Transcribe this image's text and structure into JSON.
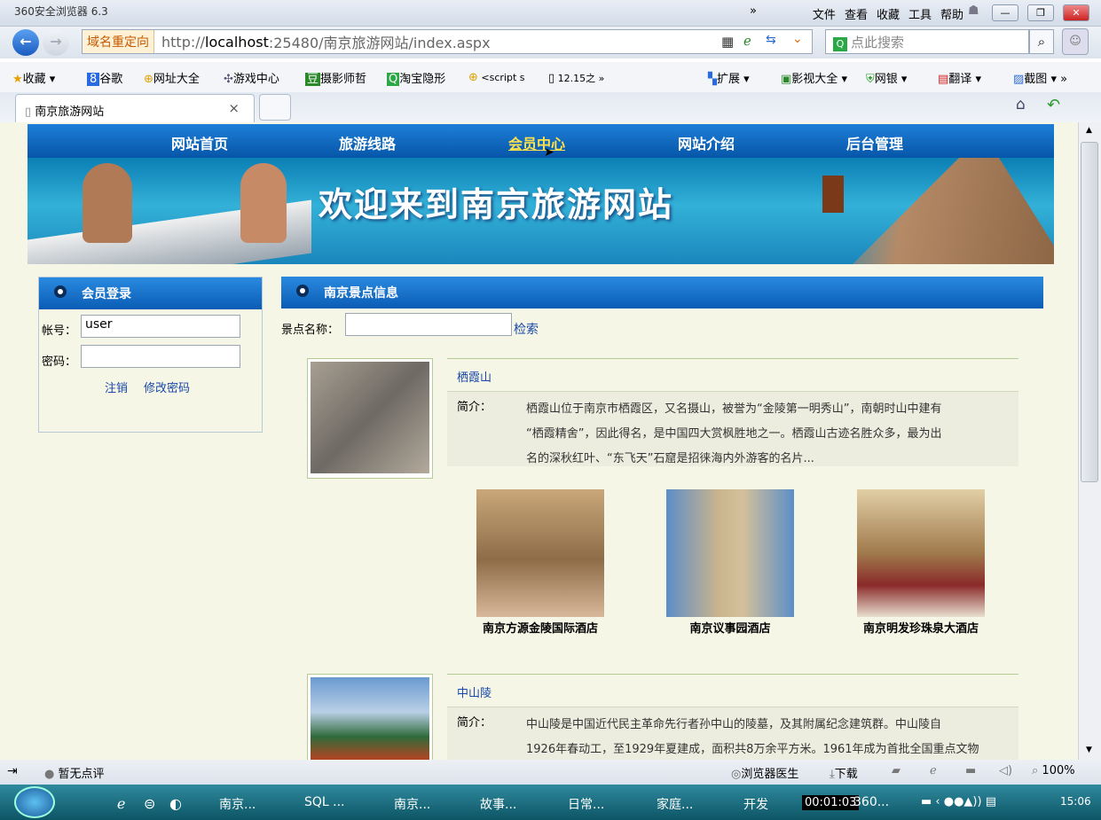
{
  "browser": {
    "title": "360安全浏览器 6.3",
    "menus": [
      "文件",
      "查看",
      "收藏",
      "工具",
      "帮助"
    ],
    "redirect_label": "域名重定向",
    "address_prefix": "http://",
    "address_host": "localhost",
    "address_rest": ":25480/南京旅游网站/index.aspx",
    "search_placeholder": "点此搜索"
  },
  "favorites": [
    "收藏",
    "谷歌",
    "网址大全",
    "游戏中心",
    "摄影师哲",
    "淘宝隐形",
    "<script s",
    "12.15之"
  ],
  "favorites_right": [
    "扩展",
    "影视大全",
    "网银",
    "翻译",
    "截图"
  ],
  "tab": {
    "title": "南京旅游网站",
    "close": "×"
  },
  "site": {
    "nav": [
      "网站首页",
      "旅游线路",
      "会员中心",
      "网站介绍",
      "后台管理"
    ],
    "banner_text": "欢迎来到南京旅游网站",
    "login": {
      "header": "会员登录",
      "account_label": "帐号：",
      "account_value": "user",
      "password_label": "密码：",
      "password_value": "",
      "logout": "注销",
      "change_password": "修改密码"
    },
    "scenic": {
      "header": "南京景点信息",
      "search_label": "景点名称：",
      "search_value": "",
      "search_button": "检索",
      "items": [
        {
          "name": "栖霞山",
          "intro_label": "简介：",
          "intro_lines": [
            "栖霞山位于南京市栖霞区，又名摄山，被誉为“金陵第一明秀山”，南朝时山中建有",
            "“栖霞精舍”，因此得名，是中国四大赏枫胜地之一。栖霞山古迹名胜众多，最为出",
            "名的深秋红叶、“东飞天”石窟是招徕海内外游客的名片..."
          ],
          "hotels": [
            "南京方源金陵国际酒店",
            "南京议事园酒店",
            "南京明发珍珠泉大酒店"
          ]
        },
        {
          "name": "中山陵",
          "intro_label": "简介：",
          "intro_lines": [
            "中山陵是中国近代民主革命先行者孙中山的陵墓，及其附属纪念建筑群。中山陵自",
            "1926年春动工，至1929年夏建成，面积共8万余平方米。1961年成为首批全国重点文物"
          ]
        }
      ]
    }
  },
  "status": {
    "left": "暂无点评",
    "doctor": "浏览器医生",
    "download": "下载",
    "zoom": "100%"
  },
  "taskbar": {
    "items": [
      "南京...",
      "SQL ...",
      "南京...",
      "故事...",
      "日常...",
      "家庭...",
      "开发",
      "360..."
    ],
    "timer": "00:01:03",
    "clock": "15:06"
  }
}
